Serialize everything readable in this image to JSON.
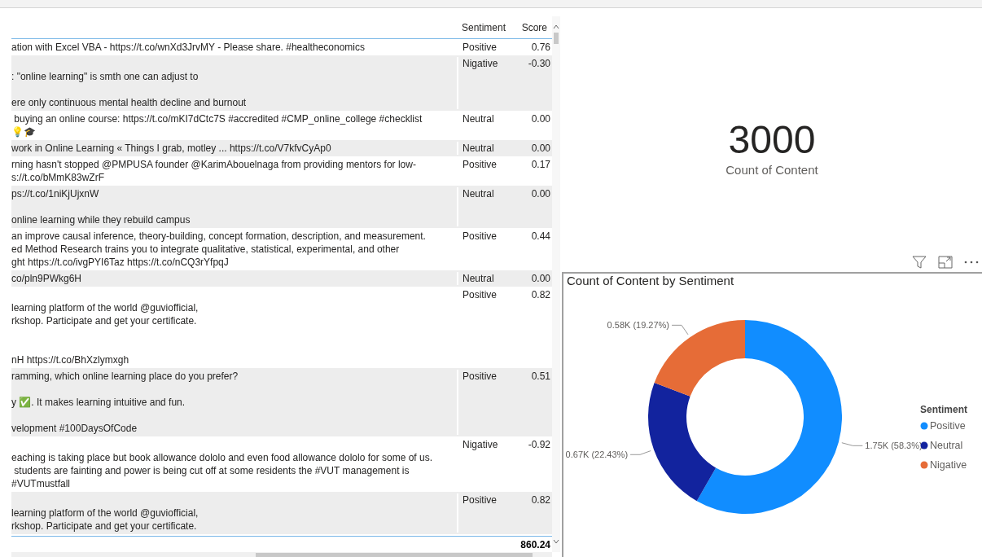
{
  "table": {
    "columns": [
      "Sentiment",
      "Score"
    ],
    "rows": [
      {
        "content": "ation with Excel VBA - https://t.co/wnXd3JrvMY - Please share. #healtheconomics",
        "sentiment": "Positive",
        "score": "0.76"
      },
      {
        "content": "\n: \"online learning\" is smth one can adjust to\n\nere only continuous mental health decline and burnout",
        "sentiment": "Nigative",
        "score": "-0.30"
      },
      {
        "content": " buying an online course: https://t.co/mKI7dCtc7S #accredited #CMP_online_college #checklist\n💡🎓",
        "sentiment": "Neutral",
        "score": "0.00"
      },
      {
        "content": "work in Online Learning « Things I grab, motley ... https://t.co/V7kfvCyAp0",
        "sentiment": "Neutral",
        "score": "0.00"
      },
      {
        "content": "rning hasn't stopped @PMPUSA founder @KarimAbouelnaga from providing mentors for low-\ns://t.co/bMmK83wZrF",
        "sentiment": "Positive",
        "score": "0.17"
      },
      {
        "content": "ps://t.co/1niKjUjxnW\n\nonline learning while they rebuild campus",
        "sentiment": "Neutral",
        "score": "0.00"
      },
      {
        "content": "an improve causal inference, theory-building, concept formation, description, and measurement.\ned Method Research trains you to integrate qualitative, statistical, experimental, and other\nght https://t.co/ivgPYI6Taz https://t.co/nCQ3rYfpqJ",
        "sentiment": "Positive",
        "score": "0.44"
      },
      {
        "content": "co/pln9PWkg6H",
        "sentiment": "Neutral",
        "score": "0.00"
      },
      {
        "content": "\nlearning platform of the world @guviofficial,\nrkshop. Participate and get your certificate.\n\n\nnH https://t.co/BhXzlymxgh",
        "sentiment": "Positive",
        "score": "0.82"
      },
      {
        "content": "ramming, which online learning place do you prefer?\n\ny ✅. It makes learning intuitive and fun.\n\nvelopment #100DaysOfCode",
        "sentiment": "Positive",
        "score": "0.51"
      },
      {
        "content": "\neaching is taking place but book allowance dololo and even food allowance dololo for some of us.\n students are fainting and power is being cut off at some residents the #VUT management is\n#VUTmustfall",
        "sentiment": "Nigative",
        "score": "-0.92"
      },
      {
        "content": "\nlearning platform of the world @guviofficial,\nrkshop. Participate and get your certificate.",
        "sentiment": "Positive",
        "score": "0.82"
      }
    ],
    "total": "860.24"
  },
  "card": {
    "value": "3000",
    "label": "Count of Content"
  },
  "chart": {
    "chart_data": {
      "type": "donut",
      "title": "Count of Content by Sentiment",
      "categories": [
        "Positive",
        "Neutral",
        "Nigative"
      ],
      "colors": [
        "#118dff",
        "#12239e",
        "#e66c37"
      ],
      "series": [
        {
          "values": [
            58.3,
            22.43,
            19.27
          ]
        }
      ],
      "value_labels": [
        "1.75K (58.3%)",
        "0.67K (22.43%)",
        "0.58K (19.27%)"
      ],
      "legend": {
        "title": "Sentiment"
      }
    }
  }
}
